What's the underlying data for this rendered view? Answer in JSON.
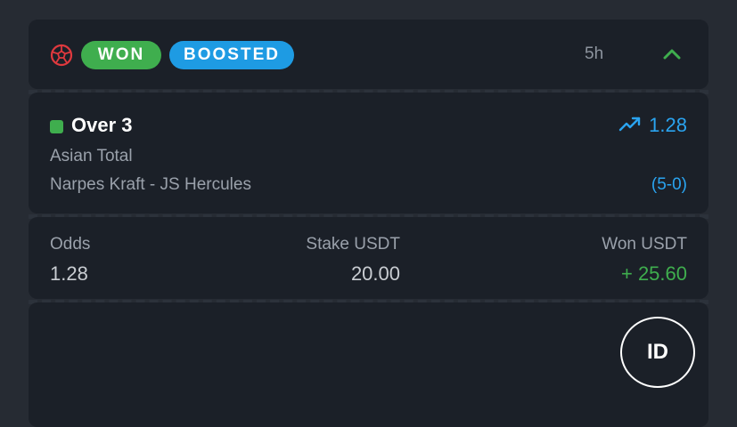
{
  "header": {
    "sport_icon": "soccer-ball-icon",
    "status_label": "WON",
    "boost_label": "BOOSTED",
    "time_ago": "5h",
    "collapse_icon": "chevron-up-icon"
  },
  "selection": {
    "status_indicator_color": "#3fae4e",
    "title": "Over 3",
    "market": "Asian Total",
    "match": "Narpes Kraft - JS Hercules",
    "trend_icon": "trending-up-icon",
    "odds": "1.28",
    "score": "(5-0)"
  },
  "summary": {
    "odds_label": "Odds",
    "odds_value": "1.28",
    "stake_label": "Stake USDT",
    "stake_value": "20.00",
    "won_label": "Won USDT",
    "won_value": "+ 25.60"
  },
  "footer": {
    "id_button_label": "ID"
  },
  "colors": {
    "won": "#3fae4e",
    "boosted": "#1e9be3",
    "accent_blue": "#2aa4f0",
    "card_bg": "#1b2028",
    "page_bg": "#262b33"
  }
}
